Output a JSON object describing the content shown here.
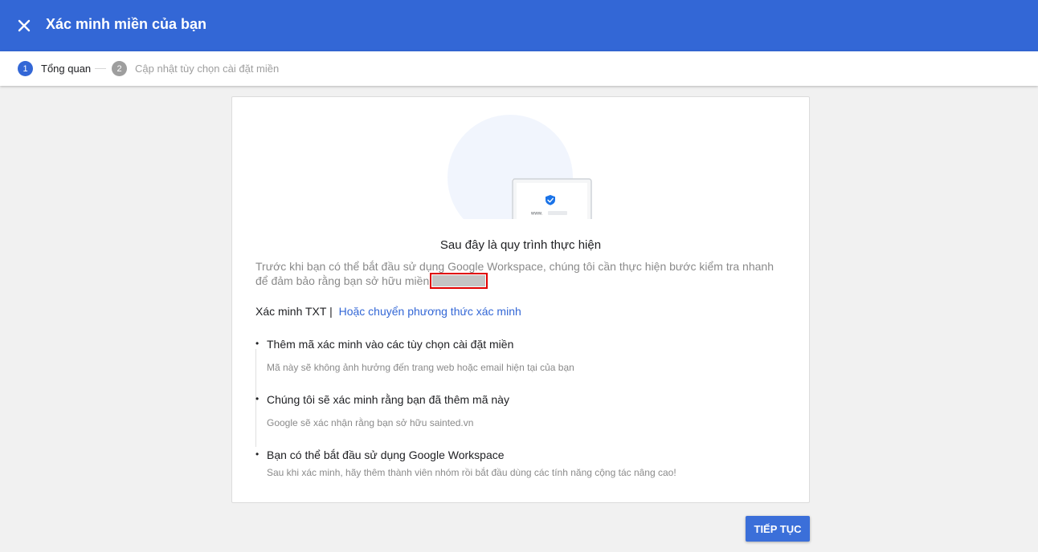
{
  "header": {
    "title": "Xác minh miền của bạn",
    "close_icon": "close-icon"
  },
  "stepper": {
    "steps": [
      {
        "number": "1",
        "label": "Tổng quan",
        "state": "active"
      },
      {
        "number": "2",
        "label": "Cập nhật tùy chọn cài đặt miền",
        "state": "inactive"
      }
    ]
  },
  "illustration": {
    "icon": "laptop-shield-illustration",
    "url_text": "www."
  },
  "card": {
    "heading": "Sau đây là quy trình thực hiện",
    "intro": "Trước khi bạn có thể bắt đầu sử dụng Google Workspace, chúng tôi cần thực hiện bước kiểm tra nhanh để đảm bảo rằng bạn sở hữu miền",
    "method_label": "Xác minh TXT |",
    "method_link": "Hoặc chuyển phương thức xác minh",
    "steps": [
      {
        "title": "Thêm mã xác minh vào các tùy chọn cài đặt miền",
        "subtitle": "Mã này sẽ không ảnh hưởng đến trang web hoặc email hiện tại của bạn"
      },
      {
        "title": "Chúng tôi sẽ xác minh rằng bạn đã thêm mã này",
        "subtitle": "Google sẽ xác nhận rằng bạn sở hữu sainted.vn"
      },
      {
        "title": "Bạn có thể bắt đầu sử dụng Google Workspace",
        "subtitle": "Sau khi xác minh, hãy thêm thành viên nhóm rồi bắt đầu dùng các tính năng cộng tác nâng cao!"
      }
    ]
  },
  "footer": {
    "continue_label": "TIẾP TỤC"
  },
  "colors": {
    "primary": "#3367d6",
    "redaction_outline": "#e00000"
  }
}
